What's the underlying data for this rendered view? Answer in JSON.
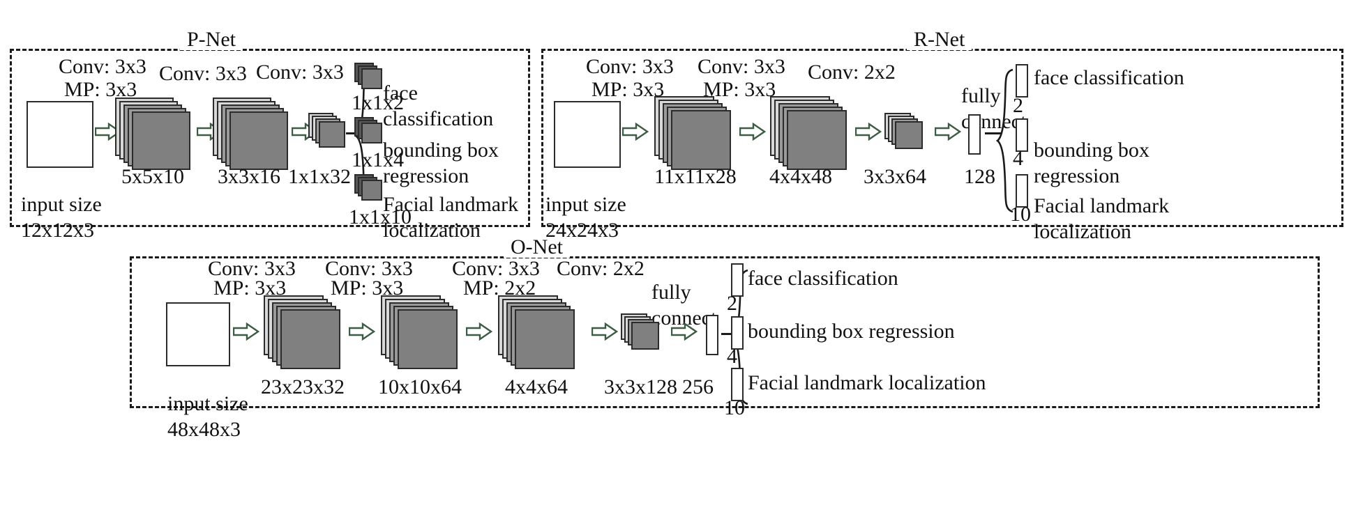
{
  "figure": {
    "background": "#ffffff",
    "block_fill": "#808080",
    "arrow_color": "#3d5c44",
    "line_color": "#1a1a1a"
  },
  "panels": [
    {
      "id": "pnet",
      "title": "P-Net",
      "input": {
        "label_line1": "input size",
        "label_line2": "12x12x3"
      },
      "ops": [
        {
          "conv": "Conv: 3x3",
          "pool": "MP: 3x3"
        },
        {
          "conv": "Conv: 3x3",
          "pool": ""
        },
        {
          "conv": "Conv: 3x3",
          "pool": ""
        }
      ],
      "shapes": [
        "5x5x10",
        "3x3x16",
        "1x1x32"
      ],
      "outputs": [
        {
          "name": "face\nclassification",
          "size": "1x1x2"
        },
        {
          "name": "bounding box\nregression",
          "size": "1x1x4"
        },
        {
          "name": "Facial landmark\nlocalization",
          "size": "1x1x10"
        }
      ]
    },
    {
      "id": "rnet",
      "title": "R-Net",
      "input": {
        "label_line1": "input size",
        "label_line2": "24x24x3"
      },
      "ops": [
        {
          "conv": "Conv: 3x3",
          "pool": "MP: 3x3"
        },
        {
          "conv": "Conv: 3x3",
          "pool": "MP: 3x3"
        },
        {
          "conv": "Conv: 2x2",
          "pool": ""
        }
      ],
      "fc_label": "fully\nconnect",
      "shapes": [
        "11x11x28",
        "4x4x48",
        "3x3x64"
      ],
      "fc_size": "128",
      "outputs": [
        {
          "name": "face classification",
          "size": "2"
        },
        {
          "name": "bounding box\nregression",
          "size": "4"
        },
        {
          "name": "Facial landmark\nlocalization",
          "size": "10"
        }
      ]
    },
    {
      "id": "onet",
      "title": "O-Net",
      "input": {
        "label_line1": "input size",
        "label_line2": "48x48x3"
      },
      "ops": [
        {
          "conv": "Conv: 3x3",
          "pool": "MP: 3x3"
        },
        {
          "conv": "Conv: 3x3",
          "pool": "MP: 3x3"
        },
        {
          "conv": "Conv: 3x3",
          "pool": "MP: 2x2"
        },
        {
          "conv": "Conv: 2x2",
          "pool": ""
        }
      ],
      "fc_label": "fully\nconnect",
      "shapes": [
        "23x23x32",
        "10x10x64",
        "4x4x64",
        "3x3x128"
      ],
      "fc_size": "256",
      "outputs": [
        {
          "name": "face classification",
          "size": "2"
        },
        {
          "name": "bounding box regression",
          "size": "4"
        },
        {
          "name": "Facial landmark localization",
          "size": "10"
        }
      ]
    }
  ]
}
